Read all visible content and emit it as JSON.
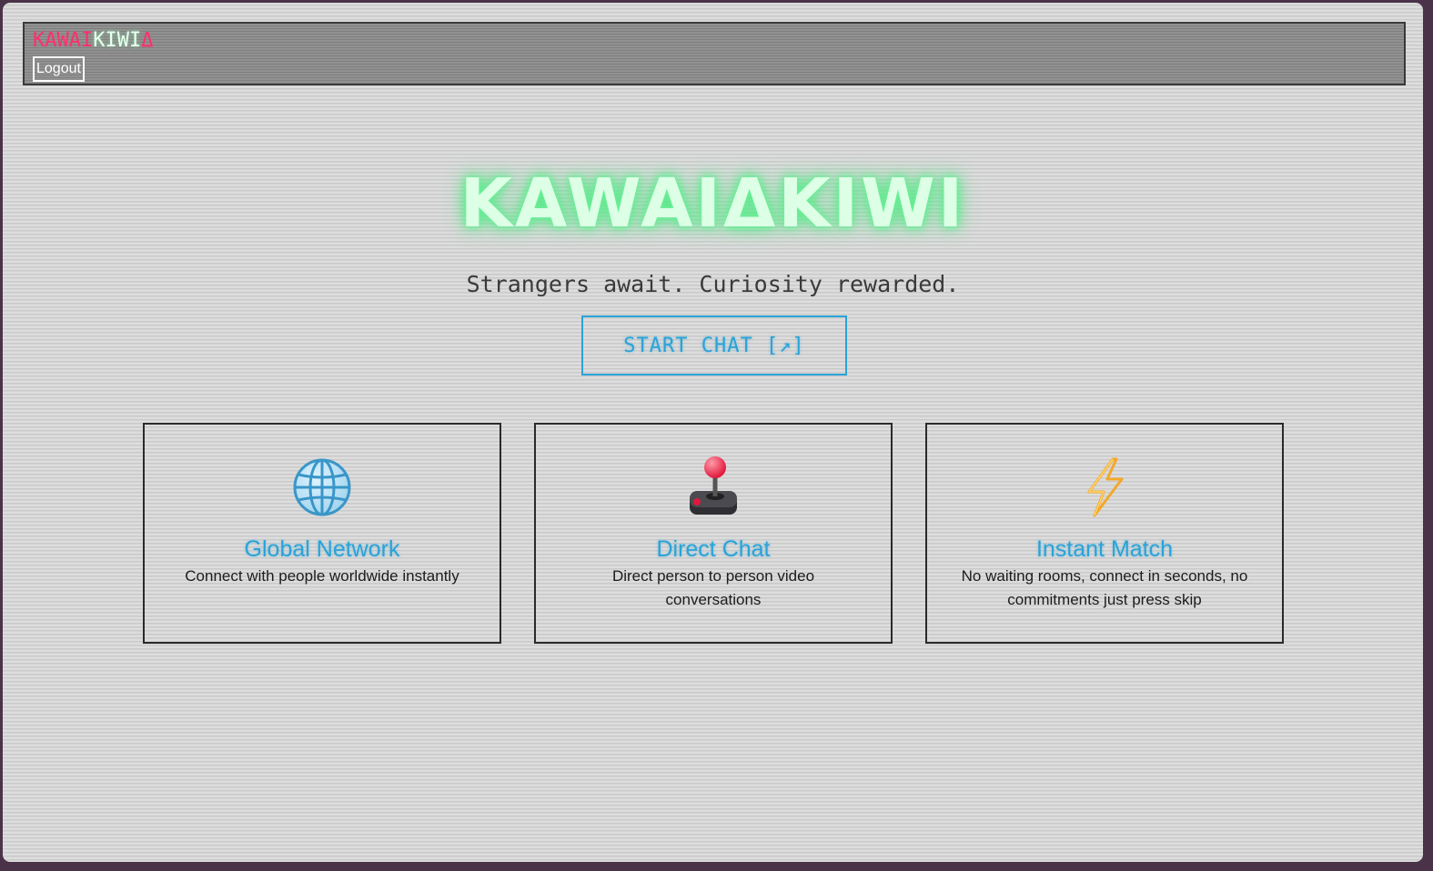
{
  "navbar": {
    "logo_part1": "KAWAI",
    "logo_part2": "KIWI",
    "logo_part3": "Δ",
    "logout_label": "Logout"
  },
  "hero": {
    "title": "KAWAIΔKIWI",
    "subtitle": "Strangers await. Curiosity rewarded.",
    "start_label": "START CHAT [↗]"
  },
  "features": [
    {
      "icon": "globe-icon",
      "title": "Global Network",
      "description": "Connect with people worldwide instantly"
    },
    {
      "icon": "joystick-icon",
      "title": "Direct Chat",
      "description": "Direct person to person video conversations"
    },
    {
      "icon": "lightning-icon",
      "title": "Instant Match",
      "description": "No waiting rooms, connect in seconds, no commitments just press skip"
    }
  ],
  "colors": {
    "accent_blue": "#2aa3d8",
    "logo_pink": "#ff2f6d",
    "title_glow": "#54e887"
  }
}
